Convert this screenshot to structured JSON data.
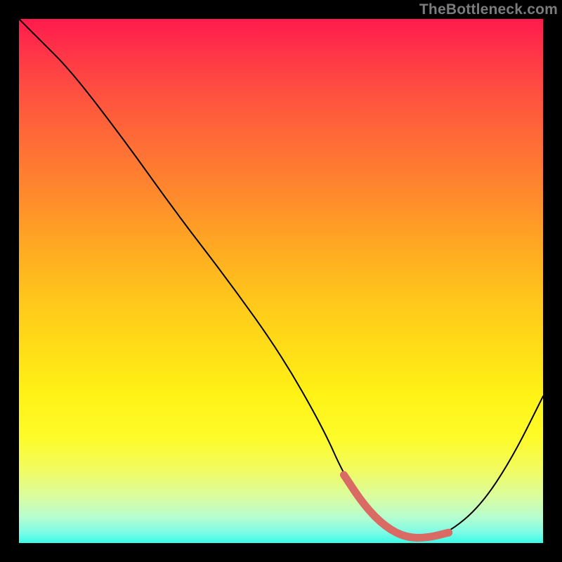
{
  "watermark": "TheBottleneck.com",
  "chart_data": {
    "type": "line",
    "title": "",
    "xlabel": "",
    "ylabel": "",
    "xlim": [
      0,
      100
    ],
    "ylim": [
      0,
      100
    ],
    "grid": false,
    "series": [
      {
        "name": "bottleneck-curve",
        "x": [
          0,
          4,
          10,
          20,
          30,
          40,
          50,
          58,
          62,
          66,
          70,
          74,
          78,
          82,
          88,
          94,
          100
        ],
        "y": [
          100,
          96,
          90,
          77,
          63,
          50,
          36,
          22,
          13,
          7,
          3,
          1,
          1,
          2,
          7,
          16,
          28
        ]
      }
    ],
    "highlight": {
      "name": "sweet-spot",
      "x": [
        62,
        66,
        70,
        74,
        78,
        82
      ],
      "y": [
        13,
        7,
        3,
        1,
        1,
        2
      ]
    },
    "colors": {
      "curve": "#000000",
      "highlight": "#d96a64"
    }
  }
}
